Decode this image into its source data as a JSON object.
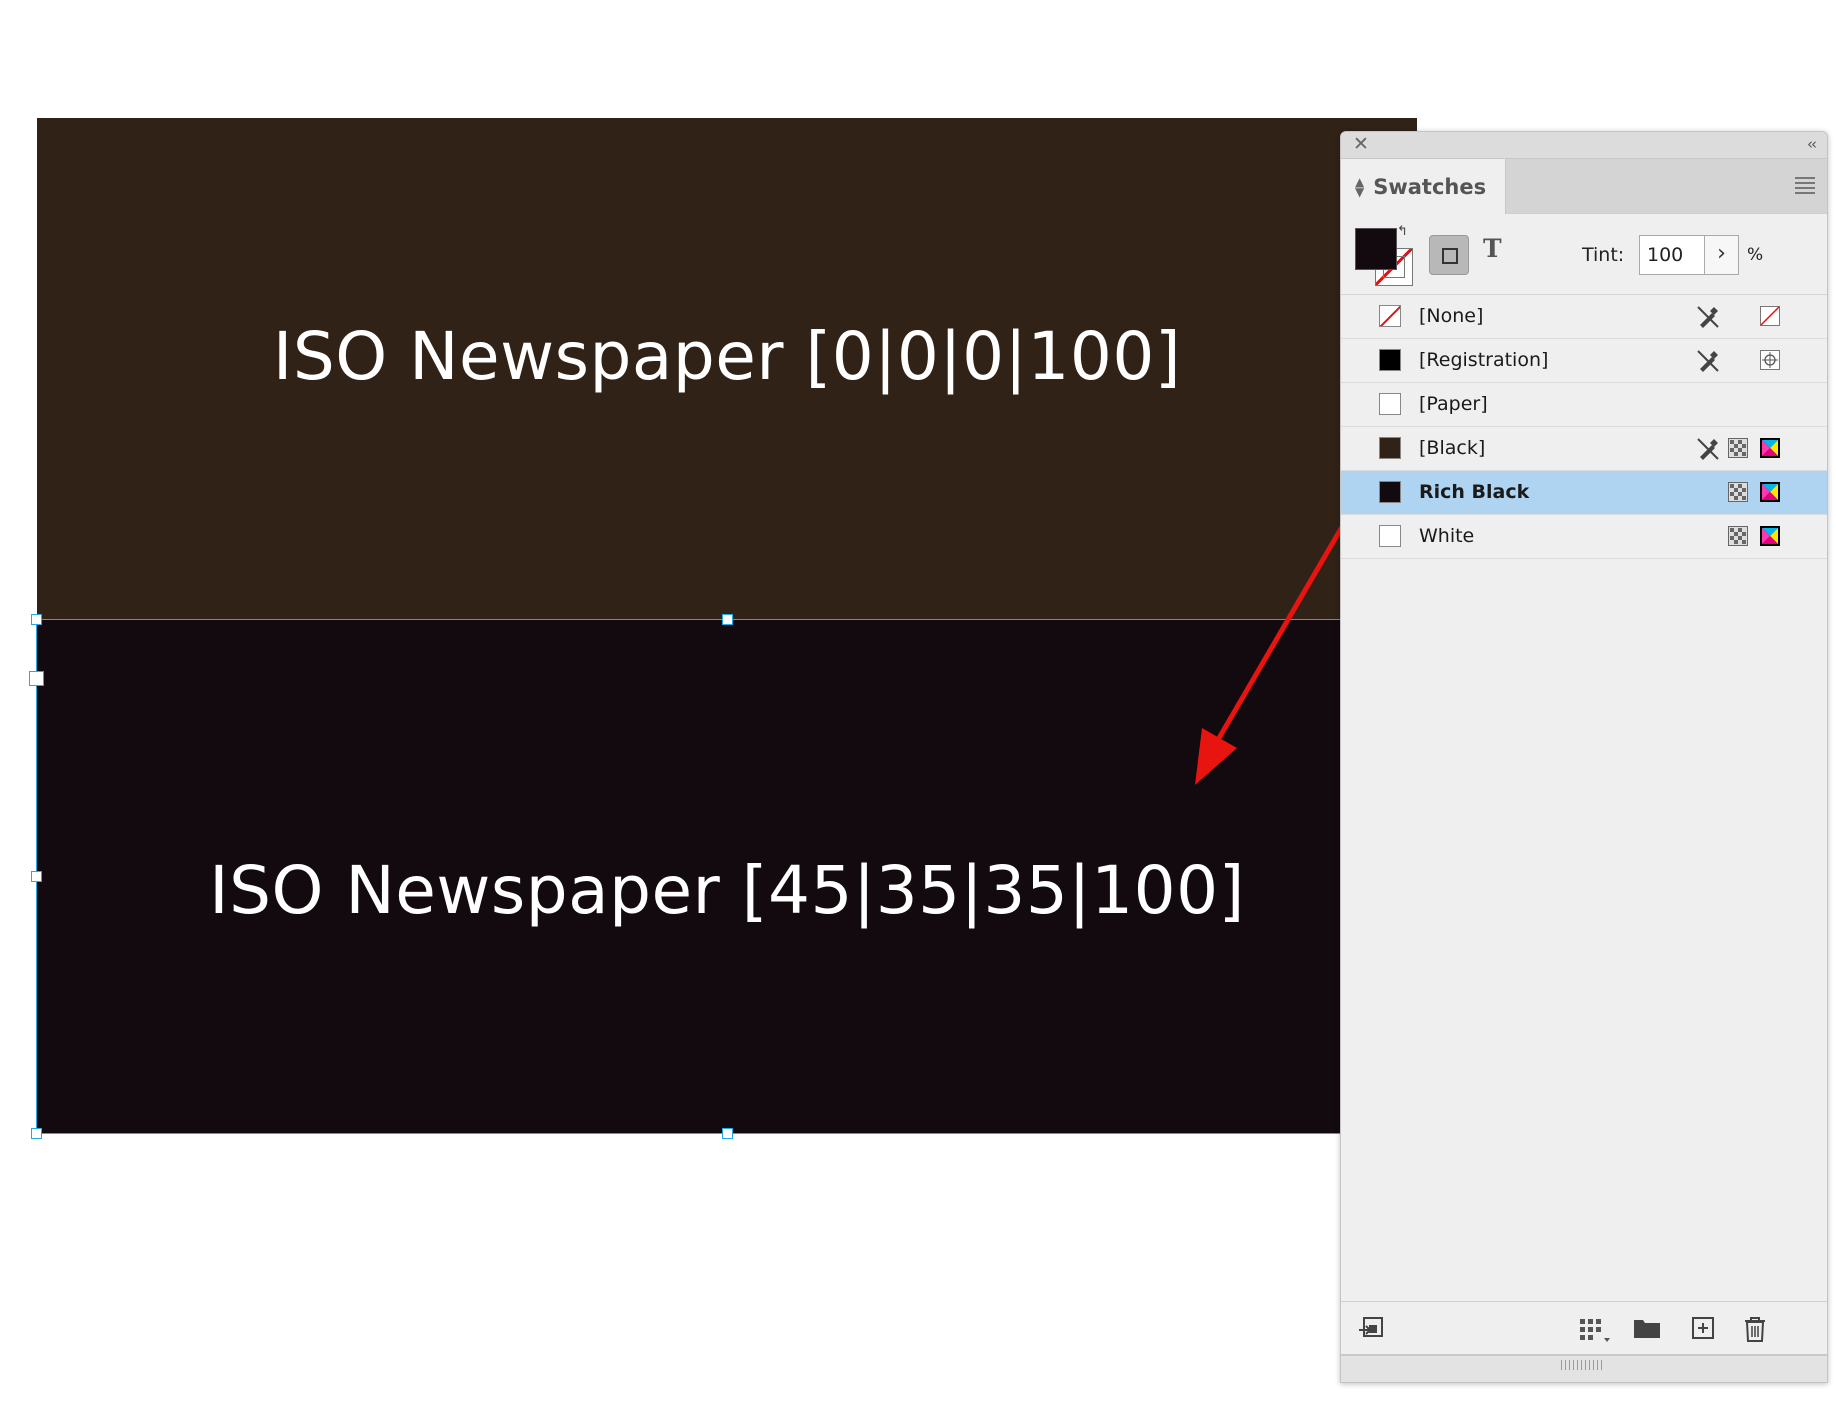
{
  "canvas": {
    "top_rect": {
      "label": "ISO Newspaper [0|0|0|100]",
      "fill": "#312217"
    },
    "bottom_rect": {
      "label": "ISO Newspaper [45|35|35|100]",
      "fill": "#120a0f"
    },
    "selection_color": "#29a8e0",
    "annotation_arrow_color": "#e8140f"
  },
  "panel": {
    "title": "Swatches",
    "close_icon": "close-icon",
    "collapse_icon": "collapse-icon",
    "menu_icon": "panel-menu-icon",
    "tint_label": "Tint:",
    "tint_value": "100",
    "tint_unit": "%",
    "fill_color": "#120a0f",
    "swatches": [
      {
        "name": "[None]",
        "chip": "none",
        "color": "#ffffff",
        "icons": [
          "no-edit-icon",
          "none-mode-icon"
        ]
      },
      {
        "name": "[Registration]",
        "chip": "solid",
        "color": "#000000",
        "icons": [
          "no-edit-icon",
          "registration-icon"
        ]
      },
      {
        "name": "[Paper]",
        "chip": "solid",
        "color": "#ffffff",
        "icons": []
      },
      {
        "name": "[Black]",
        "chip": "solid",
        "color": "#312217",
        "icons": [
          "no-edit-icon",
          "process-icon",
          "cmyk-icon"
        ]
      },
      {
        "name": "Rich Black",
        "chip": "solid",
        "color": "#120a0f",
        "icons": [
          "process-icon",
          "cmyk-icon"
        ],
        "selected": true
      },
      {
        "name": "White",
        "chip": "solid",
        "color": "#ffffff",
        "icons": [
          "process-icon",
          "cmyk-icon"
        ]
      }
    ],
    "bottom_icons": [
      "import-swatch-icon",
      "swatch-views-icon",
      "new-color-group-icon",
      "new-swatch-icon",
      "delete-swatch-icon"
    ]
  }
}
